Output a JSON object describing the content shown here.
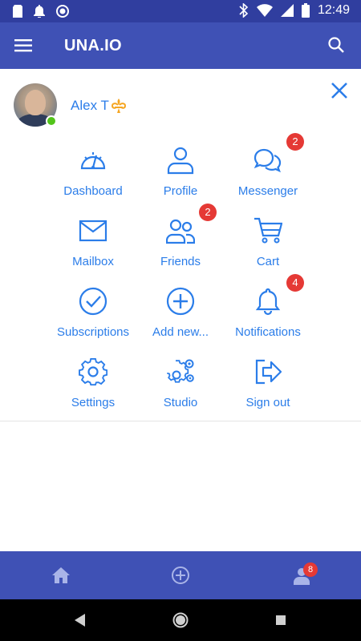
{
  "status_bar": {
    "time": "12:49",
    "left_icons": [
      "sd-card-icon",
      "notification-bell-icon",
      "circle-icon"
    ],
    "right_icons": [
      "bluetooth-icon",
      "wifi-icon",
      "signal-icon",
      "battery-icon"
    ]
  },
  "app_bar": {
    "title": "UNA.IO",
    "menu_icon": "hamburger-menu-icon",
    "search_icon": "search-icon",
    "background": "#3f51b5"
  },
  "user": {
    "name": "Alex T",
    "badge_icon": "fleur-de-lis-icon",
    "online": true
  },
  "menu": [
    {
      "label": "Dashboard",
      "icon": "speedometer-icon"
    },
    {
      "label": "Profile",
      "icon": "person-icon"
    },
    {
      "label": "Messenger",
      "icon": "chat-bubbles-icon",
      "badge": "2"
    },
    {
      "label": "Mailbox",
      "icon": "envelope-icon"
    },
    {
      "label": "Friends",
      "icon": "people-icon",
      "badge": "2"
    },
    {
      "label": "Cart",
      "icon": "shopping-cart-icon"
    },
    {
      "label": "Subscriptions",
      "icon": "check-circle-icon"
    },
    {
      "label": "Add new...",
      "icon": "plus-circle-icon"
    },
    {
      "label": "Notifications",
      "icon": "bell-icon",
      "badge": "4"
    },
    {
      "label": "Settings",
      "icon": "gear-icon"
    },
    {
      "label": "Studio",
      "icon": "gears-icon"
    },
    {
      "label": "Sign out",
      "icon": "sign-out-icon"
    }
  ],
  "bottom_bar": {
    "items": [
      "home-icon",
      "add-circle-icon",
      "account-icon"
    ],
    "account_badge": "8"
  },
  "colors": {
    "accent": "#2b7de9",
    "badge": "#e53935",
    "online": "#52c41a",
    "status_bar": "#303e9f"
  }
}
